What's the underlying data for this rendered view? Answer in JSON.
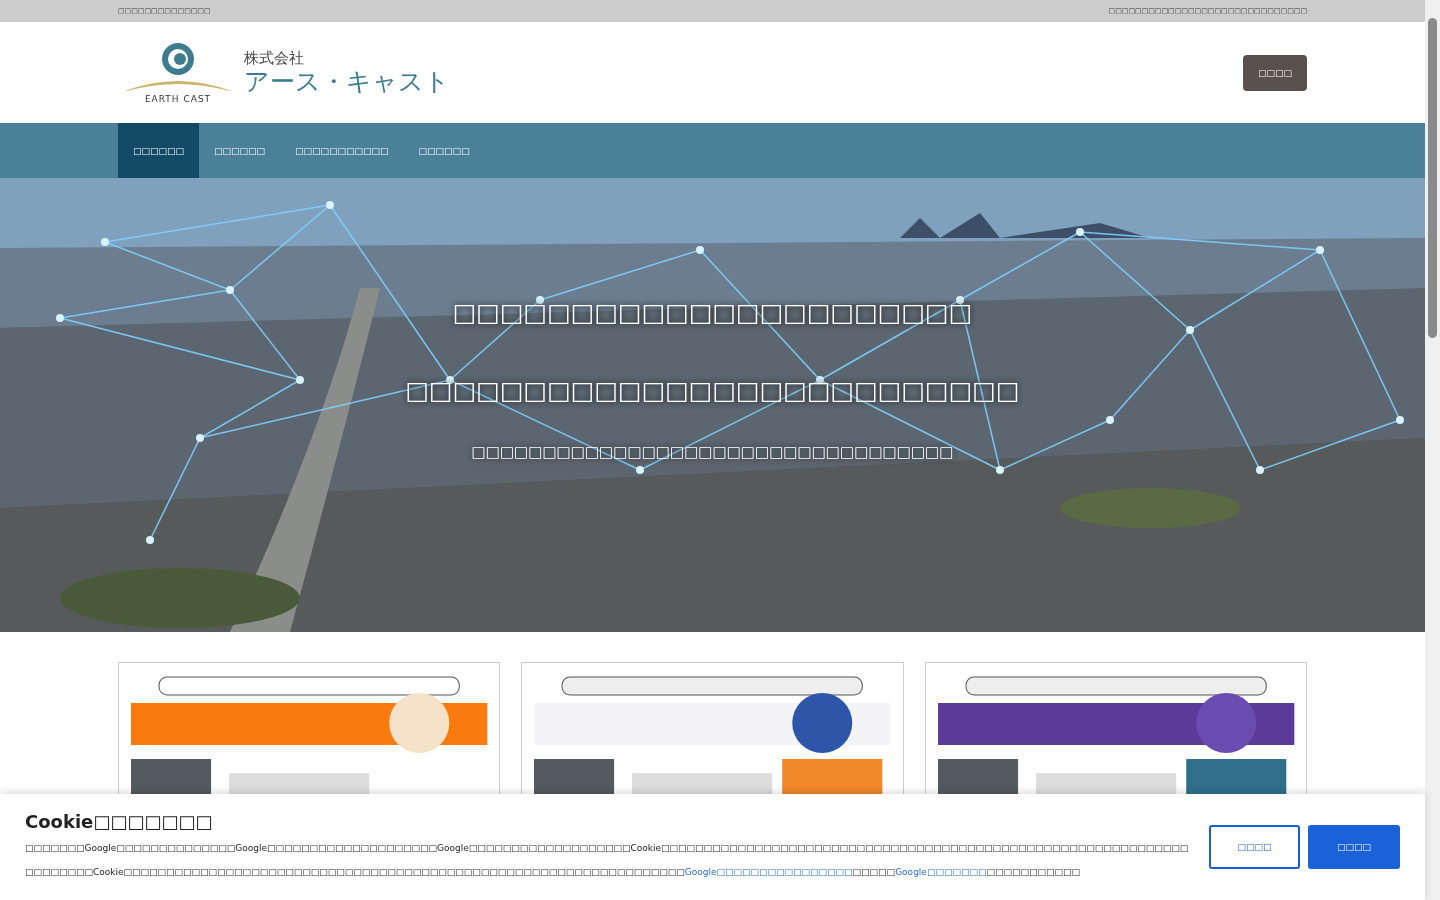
{
  "top_bar": {
    "left": "□□□□□□□□□□□□□□",
    "right": "□□□□□□□□□□□□□□□□□□□□□□□□□□□□□□"
  },
  "header": {
    "logo": {
      "company_type": "株式会社",
      "name": "アース・キャスト",
      "romaji": "EARTH CAST"
    },
    "contact_button": "□□□□"
  },
  "nav": [
    {
      "label": "□□□□□□",
      "selected": true
    },
    {
      "label": "□□□□□□",
      "selected": false
    },
    {
      "label": "□□□□□□□□□□□",
      "selected": false
    },
    {
      "label": "□□□□□□",
      "selected": false
    }
  ],
  "hero": {
    "kind": "picture",
    "lines": [
      "□□□□□□□□□□□□□□□□□□□□□□",
      "□□□□□□□□□□□□□□□□□□□□□□□□□□"
    ],
    "subline": "□□□□□□□□□□□□□□□□□□□□□□□□□□□□□□□□□□"
  },
  "cookie_notice": {
    "title": "Cookie□□□□□□□",
    "text": "□□□□□□□Google□□□□□□□□□□□□□□Google□□□□□□□□□□□□□□□□□□□□Google□□□□□□□□□□□□□□□□□□□Cookie□□□□□□□□□□□□□□□□□□□□□□□□□□□□□□□□□□□□□□□□□□□□□□□□□□□□□□□□□□□□□□□□□□□□□□Cookie□□□□□□□□□□□□□□□□□□□□□□□□□□□□□□□□□□□□□□□□□□□□□□□□□□□□□□□□□□□□□□□□□□",
    "links": [
      "Google□□□□□□□□□□□□□□□□",
      "Google□□□□□□□"
    ],
    "between": "□□□□□",
    "after": "□□□□□□□□□□□",
    "buttons": [
      {
        "label": "□□□□",
        "kind": "outline"
      },
      {
        "label": "□□□□",
        "kind": "primary"
      }
    ]
  }
}
